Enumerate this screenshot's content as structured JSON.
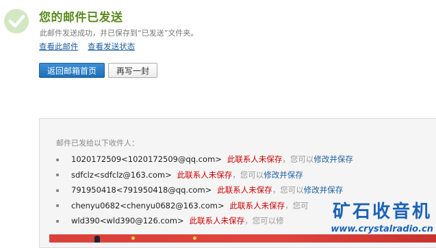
{
  "header": {
    "title": "您的邮件已发送",
    "subtitle": "此邮件发送成功，并已保存到“已发送”文件夹。",
    "links": [
      "查看此邮件",
      "查看发送状态"
    ]
  },
  "buttons": {
    "back_home": "返回邮箱首页",
    "write_again": "再写一封"
  },
  "recipients_panel": {
    "heading": "邮件已发给以下收件人：",
    "recipients": [
      {
        "address": "1020172509<1020172509@qq.com>",
        "status": "此联系人未保存",
        "separator": "，",
        "hint": "您可以",
        "action": "修改并保存"
      },
      {
        "address": "sdfclz<sdfclz@163.com>",
        "status": "此联系人未保存",
        "separator": "，",
        "hint": "您可以",
        "action": "修改并保存"
      },
      {
        "address": "791950418<791950418@qq.com>",
        "status": "此联系人未保存",
        "separator": "，",
        "hint": "您可以",
        "action": "修改并保存"
      },
      {
        "address": "chenyu0682<chenyu0682@163.com>",
        "status": "此联系人未保存",
        "separator": "，",
        "hint": "您可",
        "action": ""
      },
      {
        "address": "wld390<wld390@126.com>",
        "status": "此联系人未保存",
        "separator": "，",
        "hint": "您可以修",
        "action": ""
      }
    ]
  },
  "watermark": {
    "main": "矿石收音机",
    "sub": "www.crystalradio.cn"
  },
  "colors": {
    "success_green": "#5a8a1f",
    "link_blue": "#1e5f9e",
    "warning_red": "#cc0000",
    "primary_button": "#2a7cc7"
  },
  "icons": {
    "success": "check-circle-icon"
  }
}
